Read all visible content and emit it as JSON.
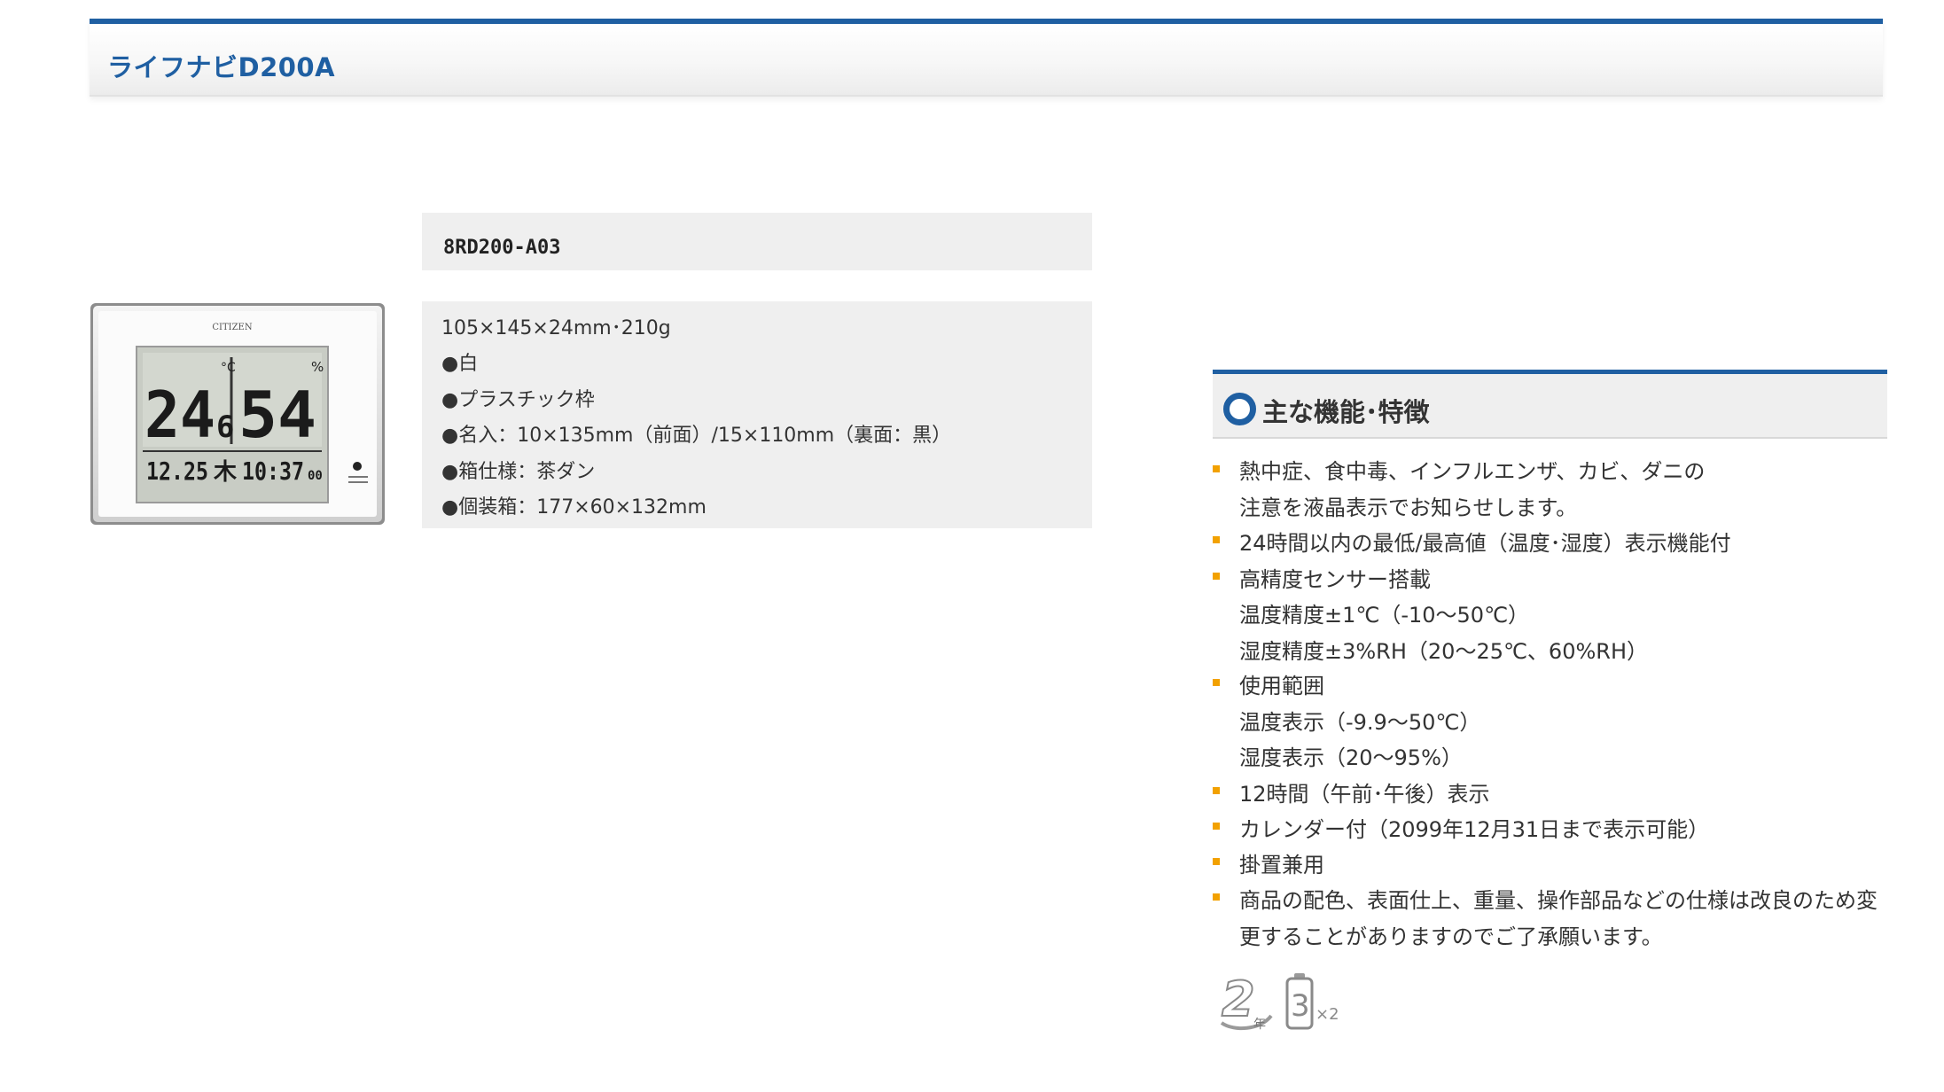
{
  "header": {
    "title": "ライフナビD200A"
  },
  "product": {
    "model": "8RD200-A03",
    "image": {
      "brand": "CITIZEN",
      "temp_label": "°C",
      "humidity_label": "%",
      "temp_value": "24",
      "temp_decimal": "6",
      "humidity_value": "54",
      "date": "12.25",
      "weekday": "木",
      "time": "10:37",
      "seconds": "00"
    },
    "specs": [
      "105×145×24mm･210g",
      "●白",
      "●プラスチック枠",
      "●名入：10×135mm（前面）/15×110mm（裏面：黒）",
      "●箱仕様：茶ダン",
      "●個装箱：177×60×132mm"
    ]
  },
  "features": {
    "heading": "主な機能･特徴",
    "lines": [
      {
        "text": "熱中症、食中毒、インフルエンザ、カビ、ダニの",
        "bullet": true
      },
      {
        "text": "注意を液晶表示でお知らせします。",
        "bullet": false
      },
      {
        "text": "24時間以内の最低/最高値（温度･湿度）表示機能付",
        "bullet": true
      },
      {
        "text": "高精度センサー搭載",
        "bullet": true
      },
      {
        "text": "温度精度±1℃（-10～50℃）",
        "bullet": false
      },
      {
        "text": "湿度精度±3%RH（20～25℃、60%RH）",
        "bullet": false
      },
      {
        "text": "使用範囲",
        "bullet": true
      },
      {
        "text": "温度表示（-9.9～50℃）",
        "bullet": false
      },
      {
        "text": "湿度表示（20～95%）",
        "bullet": false
      },
      {
        "text": "12時間（午前･午後）表示",
        "bullet": true
      },
      {
        "text": "カレンダー付（2099年12月31日まで表示可能）",
        "bullet": true
      },
      {
        "text": "掛置兼用",
        "bullet": true
      },
      {
        "text": "商品の配色、表面仕上、重量、操作部品などの仕様は改良のため変",
        "bullet": true
      },
      {
        "text": "更することがありますのでご了承願います。",
        "bullet": false
      }
    ],
    "icons": {
      "warranty_number": "2",
      "warranty_unit": "年",
      "battery_size": "3",
      "battery_count": "×2"
    }
  },
  "colors": {
    "accent": "#1f5fa2",
    "bullet": "#f2a100",
    "box_bg": "#efefef"
  }
}
